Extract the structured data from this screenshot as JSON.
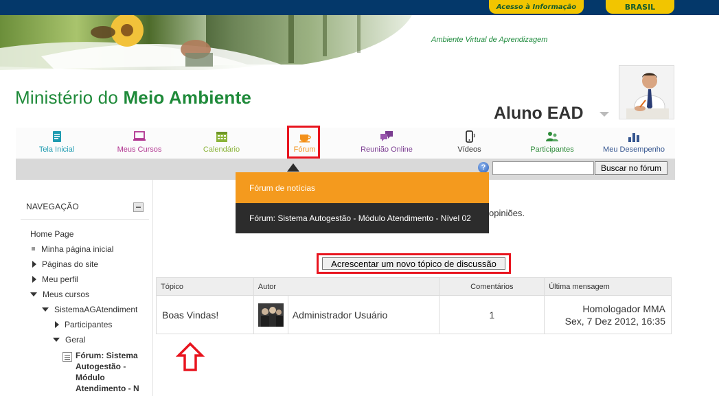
{
  "gov_bar": {
    "acesso_label": "Acesso à Informação",
    "brasil_label": "BRASIL"
  },
  "banner": {
    "ava_label": "Ambiente Virtual de Aprendizagem"
  },
  "site": {
    "title_part1": "Ministério do",
    "title_part2": "Meio Ambiente"
  },
  "user": {
    "name": "Aluno EAD"
  },
  "nav": {
    "items": [
      {
        "label": "Tela Inicial",
        "icon": "document-icon",
        "color": "#1f9bb0"
      },
      {
        "label": "Meus Cursos",
        "icon": "laptop-icon",
        "color": "#b0338f"
      },
      {
        "label": "Calendário",
        "icon": "calendar-icon",
        "color": "#8bb43a"
      },
      {
        "label": "Fórum",
        "icon": "coffee-cup-icon",
        "color": "#f39019"
      },
      {
        "label": "Reunião Online",
        "icon": "chat-bubbles-icon",
        "color": "#7b3d91"
      },
      {
        "label": "Vídeos",
        "icon": "mobile-icon",
        "color": "#333333"
      },
      {
        "label": "Participantes",
        "icon": "people-icon",
        "color": "#2e8b3a"
      },
      {
        "label": "Meu Desempenho",
        "icon": "bar-chart-icon",
        "color": "#35558f"
      }
    ]
  },
  "search": {
    "input_value": "",
    "button_label": "Buscar no fórum",
    "help_glyph": "?"
  },
  "forum_dropdown": {
    "items": [
      {
        "label": "Fórum de notícias"
      },
      {
        "label": "Fórum: Sistema Autogestão - Módulo Atendimento - Nível 02"
      }
    ]
  },
  "navigation_block": {
    "header": "NAVEGAÇÃO",
    "items": [
      {
        "label": "Home Page"
      },
      {
        "label": "Minha página inicial"
      },
      {
        "label": "Páginas do site"
      },
      {
        "label": "Meu perfil"
      },
      {
        "label": "Meus cursos"
      },
      {
        "label": "SistemaAGAtendiment"
      },
      {
        "label": "Participantes"
      },
      {
        "label": "Geral"
      },
      {
        "label": "Fórum: Sistema Autogestão - Módulo Atendimento - N"
      }
    ]
  },
  "main": {
    "intro_text": "opiniões.",
    "add_topic_label": "Acrescentar um novo tópico de discussão"
  },
  "forum_table": {
    "headers": [
      "Tópico",
      "Autor",
      "Comentários",
      "Última mensagem"
    ],
    "rows": [
      {
        "topic": "Boas Vindas!",
        "author": "Administrador Usuário",
        "comments": "1",
        "last_author": "Homologador MMA",
        "last_date": "Sex, 7 Dez 2012, 16:35"
      }
    ]
  },
  "colors": {
    "gov_blue": "#04386a",
    "gov_yellow": "#f2c500",
    "brand_green": "#1f8a3a",
    "highlight_red": "#e8141e",
    "dropdown_orange": "#f49a1e",
    "dropdown_dark": "#2c2c2c"
  }
}
